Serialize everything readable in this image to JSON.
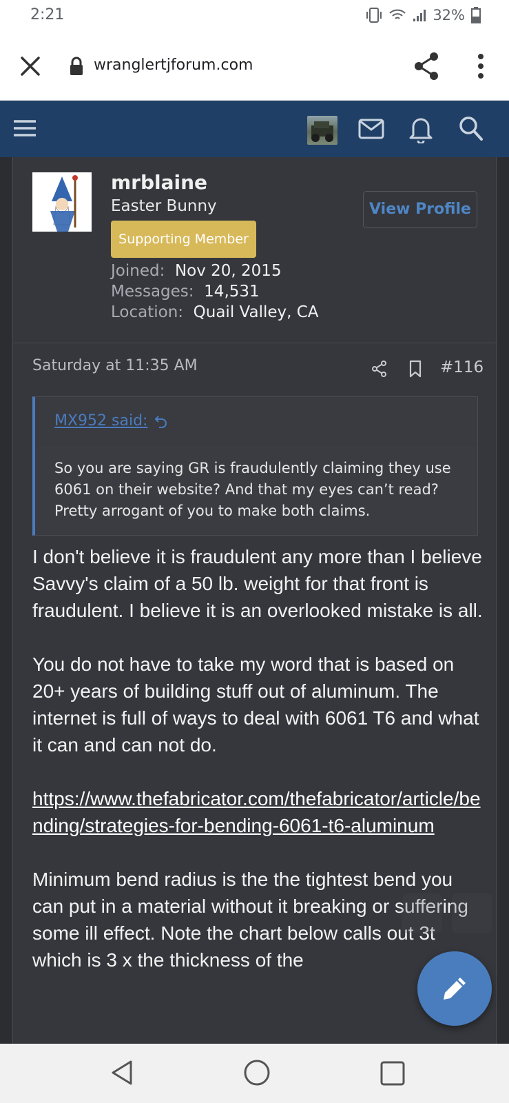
{
  "status_bar": {
    "time": "2:21",
    "battery": "32%"
  },
  "browser": {
    "url": "wranglertjforum.com"
  },
  "profile": {
    "username": "mrblaine",
    "user_title": "Easter Bunny",
    "badge": "Supporting Member",
    "view_profile_label": "View Profile",
    "joined_label": "Joined:",
    "joined_value": "Nov 20, 2015",
    "messages_label": "Messages:",
    "messages_value": "14,531",
    "location_label": "Location:",
    "location_value": "Quail Valley, CA"
  },
  "post": {
    "timestamp": "Saturday at 11:35 AM",
    "number": "#116",
    "quote": {
      "author": "MX952 said:",
      "text": "So you are saying GR is fraudulently claiming they use 6061 on their website? And that my eyes can’t read? Pretty arrogant of you to make both claims."
    },
    "paragraphs": [
      "I don't believe it is fraudulent any more than I believe Savvy's claim of a 50 lb. weight for that front is fraudulent. I believe it is an overlooked mistake is all.",
      "You do not have to take my word that is based on 20+ years of building stuff out of aluminum. The internet is full of ways to deal with 6061 T6 and what it can and can not do."
    ],
    "link": "https://www.thefabricator.com/thefabricator/article/bending/strategies-for-bending-6061-t6-aluminum",
    "last_paragraph": "Minimum bend radius is the the tightest bend you can put in a material without it breaking or suffering some ill effect. Note the chart below calls out 3t which is 3 x the thickness of the"
  },
  "icons": {
    "close": "close-icon",
    "lock": "lock-icon",
    "share": "share-icon",
    "more": "more-vert-icon",
    "menu": "menu-icon",
    "mail": "mail-icon",
    "bell": "bell-icon",
    "search": "search-icon",
    "edit": "pencil-icon",
    "back": "back-triangle-icon",
    "home": "home-circle-icon",
    "recent": "recent-square-icon"
  },
  "colors": {
    "header": "#1f3f66",
    "panel": "#35373c",
    "accent": "#4a7dbd",
    "badge": "#d8b95a"
  }
}
